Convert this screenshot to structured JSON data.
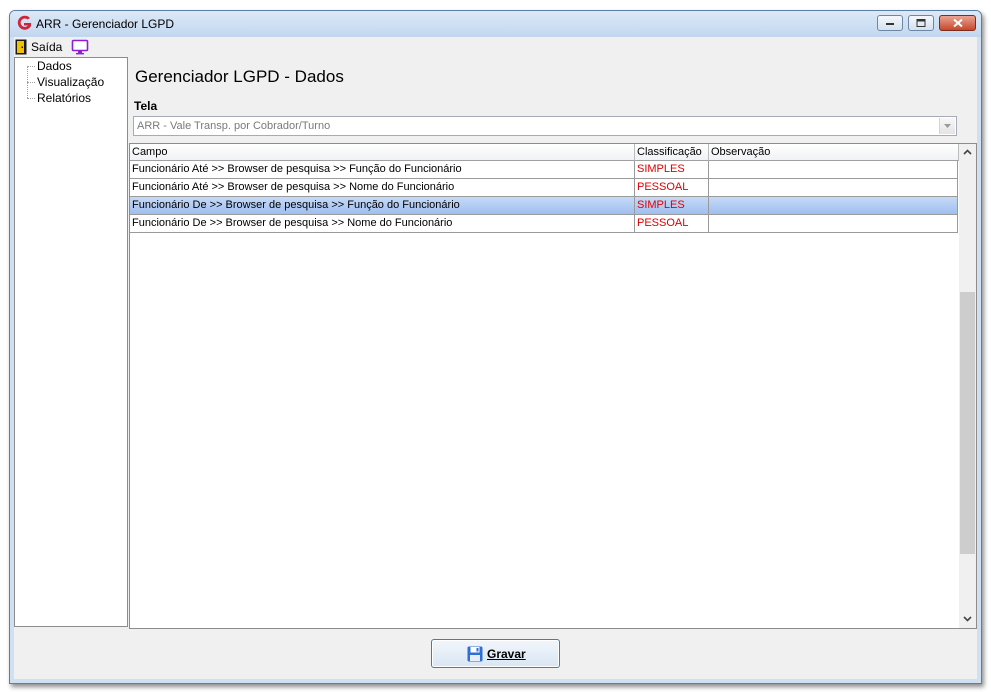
{
  "window": {
    "title": "ARR - Gerenciador LGPD"
  },
  "menubar": {
    "exit_label": "Saída"
  },
  "tree": {
    "items": [
      "Dados",
      "Visualização",
      "Relatórios"
    ]
  },
  "page": {
    "title": "Gerenciador LGPD - Dados"
  },
  "tela": {
    "label": "Tela",
    "value": "ARR - Vale Transp. por Cobrador/Turno"
  },
  "grid": {
    "columns": [
      "Campo",
      "Classificação",
      "Observação"
    ],
    "rows": [
      {
        "campo": "Funcionário Até >> Browser de pesquisa >> Função do Funcionário",
        "classificacao": "SIMPLES",
        "observacao": ""
      },
      {
        "campo": "Funcionário Até >> Browser de pesquisa >> Nome do Funcionário",
        "classificacao": "PESSOAL",
        "observacao": ""
      },
      {
        "campo": "Funcionário De >> Browser de pesquisa >> Função do Funcionário",
        "classificacao": "SIMPLES",
        "observacao": ""
      },
      {
        "campo": "Funcionário De >> Browser de pesquisa >> Nome do Funcionário",
        "classificacao": "PESSOAL",
        "observacao": ""
      }
    ],
    "selected_row_index": 2
  },
  "actions": {
    "save_label": "Gravar"
  },
  "colors": {
    "classification_text": "#e00000",
    "selection": "#a9c7f2",
    "window_frame": "#cfe0f3"
  }
}
